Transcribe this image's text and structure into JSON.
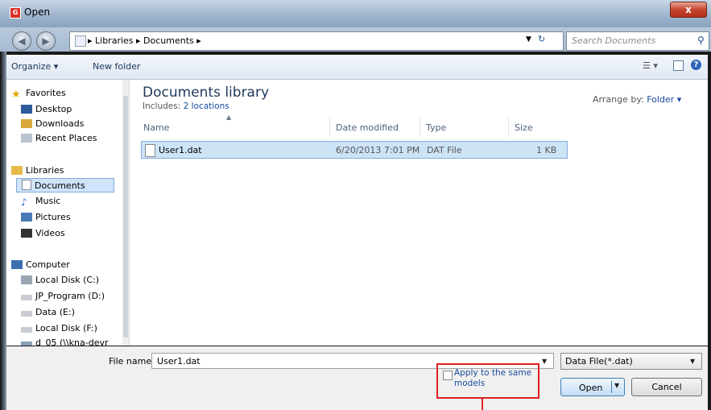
{
  "window": {
    "title": "Open",
    "app_icon": "G",
    "close": "x"
  },
  "address": {
    "back_icon": "◀",
    "forward_icon": "▶",
    "breadcrumb": "▸ Libraries ▸ Documents ▸",
    "search_placeholder": "Search Documents"
  },
  "toolbar": {
    "organize": "Organize ▾",
    "new_folder": "New folder",
    "help": "?"
  },
  "nav": {
    "favorites": "Favorites",
    "desktop": "Desktop",
    "downloads": "Downloads",
    "recent": "Recent Places",
    "libraries": "Libraries",
    "documents": "Documents",
    "music": "Music",
    "pictures": "Pictures",
    "videos": "Videos",
    "computer": "Computer",
    "disk_c": "Local Disk (C:)",
    "disk_d": "JP_Program (D:)",
    "disk_e": "Data (E:)",
    "disk_f": "Local Disk (F:)",
    "net": "d_05 (\\\\kna-devr"
  },
  "content": {
    "title": "Documents library",
    "includes": "Includes:",
    "includes_link": "2 locations",
    "arrange_label": "Arrange by:",
    "arrange_value": "Folder ▾",
    "columns": {
      "name": "Name",
      "date": "Date modified",
      "type": "Type",
      "size": "Size"
    },
    "file": {
      "name": "User1.dat",
      "date": "6/20/2013 7:01 PM",
      "type": "DAT File",
      "size": "1 KB"
    }
  },
  "bottom": {
    "file_name_label": "File name:",
    "file_name_value": "User1.dat",
    "file_type": "Data File(*.dat)",
    "apply_label": "Apply to the same models",
    "open": "Open",
    "cancel": "Cancel"
  }
}
